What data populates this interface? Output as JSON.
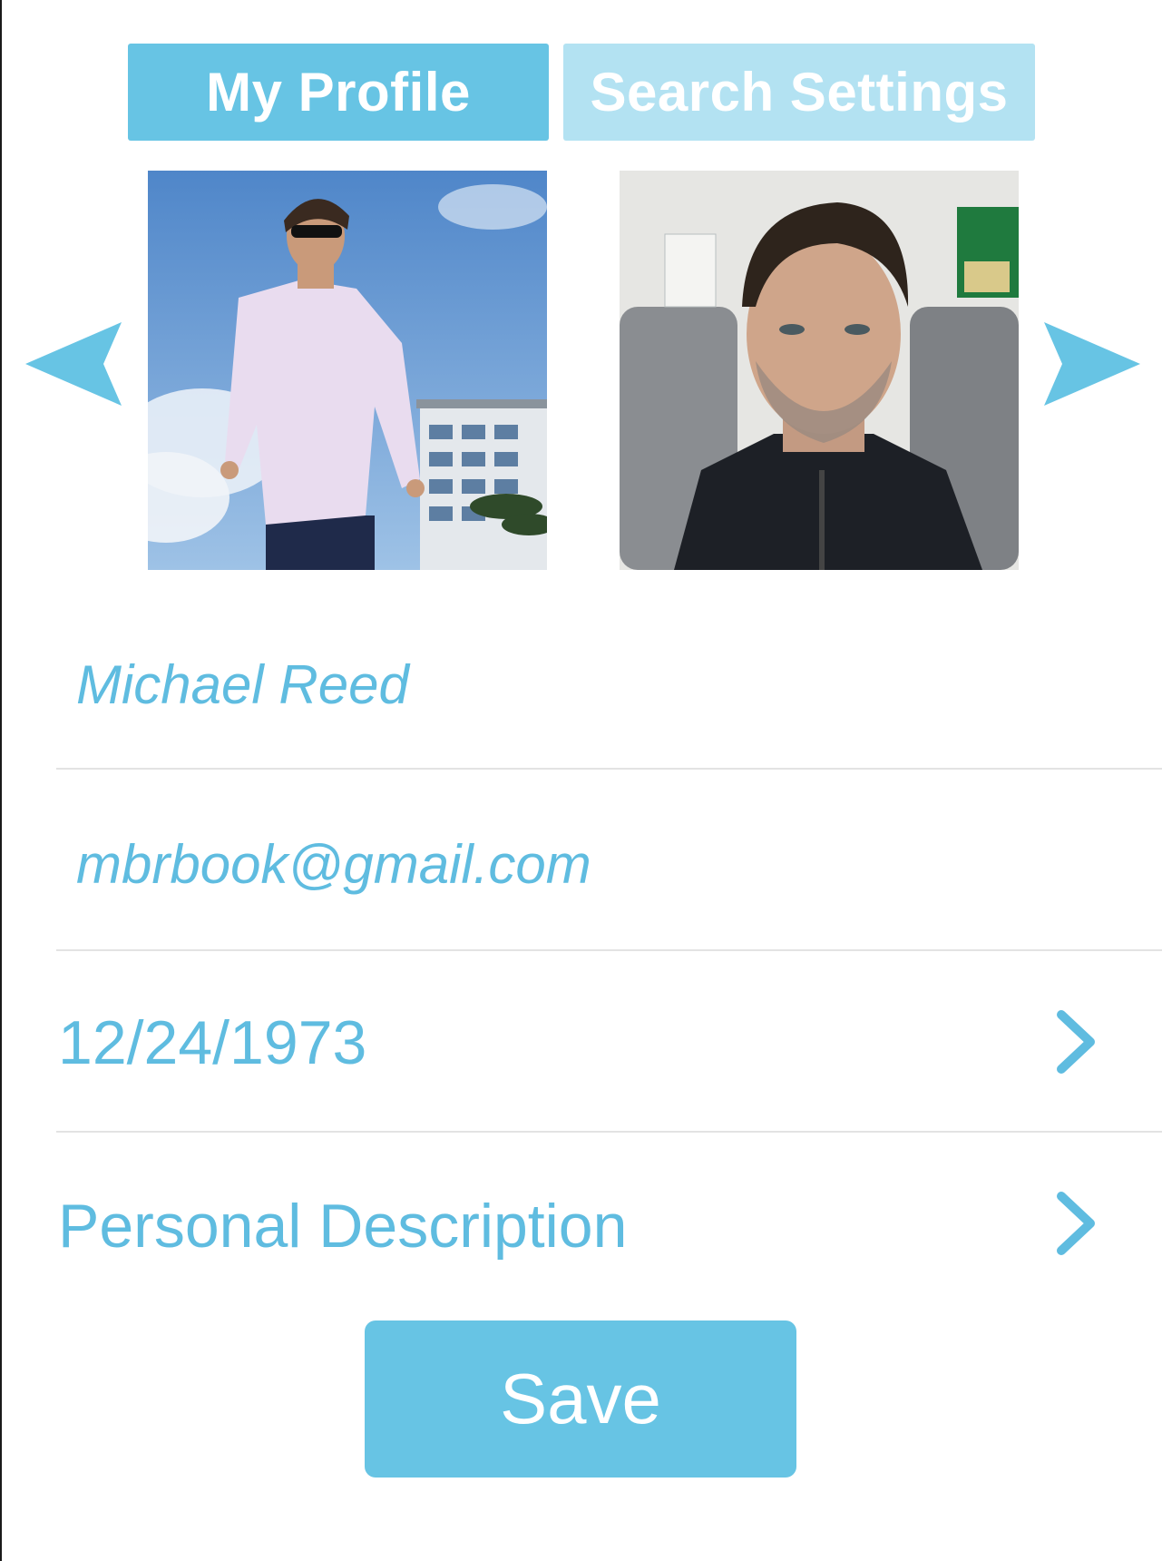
{
  "tabs": {
    "my_profile": "My Profile",
    "search_settings": "Search Settings"
  },
  "carousel": {
    "photos": [
      {
        "icon": "profile-photo-beach"
      },
      {
        "icon": "profile-photo-selfie"
      }
    ],
    "prev_icon": "triangle-left-icon",
    "next_icon": "triangle-right-icon"
  },
  "profile": {
    "name": "Michael Reed",
    "email": "mbrbook@gmail.com",
    "birthdate": "12/24/1973",
    "description_label": "Personal Description"
  },
  "actions": {
    "save_label": "Save"
  },
  "colors": {
    "accent": "#67c4e4",
    "accent_light": "#b3e2f2",
    "text_accent": "#5fbce0",
    "divider": "#e3e3e3"
  }
}
